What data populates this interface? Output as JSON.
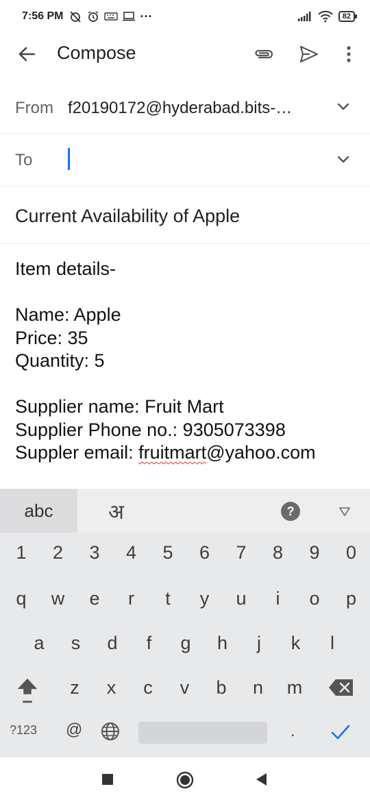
{
  "status_bar": {
    "time": "7:56 PM",
    "dots": "···",
    "battery": "82"
  },
  "app_bar": {
    "title": "Compose"
  },
  "from_field": {
    "label": "From",
    "value": "f20190172@hyderabad.bits-…"
  },
  "to_field": {
    "label": "To",
    "value": ""
  },
  "subject": "Current Availability of Apple",
  "body": {
    "heading": "Item details-",
    "name": "Name: Apple",
    "price": "Price: 35",
    "quantity": "Quantity: 5",
    "supplier_name": "Supplier name: Fruit Mart",
    "supplier_phone": "Supplier Phone no.: 9305073398",
    "supplier_email_label": "Suppler email: ",
    "supplier_email_user": "fruitmart",
    "supplier_email_domain": "@yahoo.com"
  },
  "keyboard": {
    "lang_active": "abc",
    "lang_alt": "अ",
    "help": "?",
    "number_row": [
      "1",
      "2",
      "3",
      "4",
      "5",
      "6",
      "7",
      "8",
      "9",
      "0"
    ],
    "row_q": [
      "q",
      "w",
      "e",
      "r",
      "t",
      "y",
      "u",
      "i",
      "o",
      "p"
    ],
    "row_a": [
      "a",
      "s",
      "d",
      "f",
      "g",
      "h",
      "j",
      "k",
      "l"
    ],
    "row_z": [
      "z",
      "x",
      "c",
      "v",
      "b",
      "n",
      "m"
    ],
    "symbols": "?123",
    "at": "@",
    "period": "."
  },
  "colors": {
    "accent": "#1a73e8",
    "keyboard_bg": "#e8e9eb",
    "spell_underline": "#d93025"
  }
}
